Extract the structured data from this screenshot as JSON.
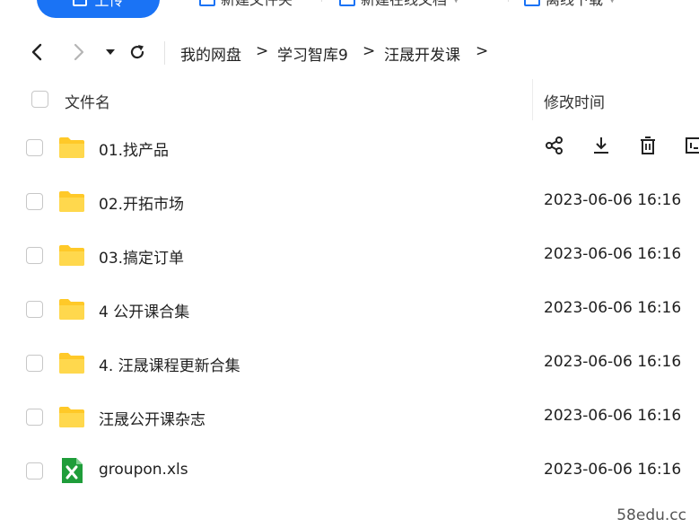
{
  "toolbar": {
    "upload_label": "上传",
    "new_folder_label": "新建文件夹",
    "new_online_doc_label": "新建在线文档",
    "offline_download_label": "离线下载"
  },
  "breadcrumb": {
    "items": [
      "我的网盘",
      "学习智库9",
      "汪晟开发课"
    ],
    "separator": ">"
  },
  "header": {
    "name_col": "文件名",
    "time_col": "修改时间"
  },
  "files": [
    {
      "name": "01.找产品",
      "type": "folder",
      "time": ""
    },
    {
      "name": "02.开拓市场",
      "type": "folder",
      "time": "2023-06-06 16:16"
    },
    {
      "name": "03.搞定订单",
      "type": "folder",
      "time": "2023-06-06 16:16"
    },
    {
      "name": "4 公开课合集",
      "type": "folder",
      "time": "2023-06-06 16:16"
    },
    {
      "name": "4. 汪晟课程更新合集",
      "type": "folder",
      "time": "2023-06-06 16:16"
    },
    {
      "name": "汪晟公开课杂志",
      "type": "folder",
      "time": "2023-06-06 16:16"
    },
    {
      "name": "groupon.xls",
      "type": "excel",
      "time": "2023-06-06 16:16"
    }
  ],
  "row_actions": [
    "share-icon",
    "download-icon",
    "delete-icon",
    "more-icon"
  ],
  "watermark": "58edu.cc",
  "colors": {
    "accent": "#1a73f5",
    "folder": "#ffd23f",
    "excel": "#1f9d3a"
  }
}
